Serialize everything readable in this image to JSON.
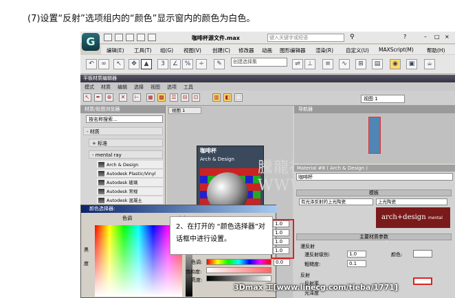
{
  "caption": "(7)设置“反射”选项组内的“颜色”显示窗内的颜色为白色。",
  "app": {
    "file_title": "咖啡杯源文件.max",
    "search_placeholder": "键入关键字或短语",
    "menus": [
      "编辑(E)",
      "工具(T)",
      "组(G)",
      "视图(V)",
      "创建(C)",
      "修改器",
      "动画",
      "图形编辑器",
      "渲染(R)",
      "自定义(U)",
      "MAXScript(M)",
      "帮助(H)"
    ],
    "selection_set": "创建选择集",
    "icons": [
      "new-file-icon",
      "open-icon",
      "save-icon",
      "undo-icon",
      "redo-icon",
      "link-icon",
      "select-icon",
      "move-icon",
      "rotate-icon",
      "scale-icon",
      "mirror-icon",
      "align-icon",
      "render-icon",
      "material-editor-icon"
    ]
  },
  "sme": {
    "title": "平板材质编辑器",
    "menus": [
      "模式",
      "材质",
      "编辑",
      "选择",
      "视图",
      "选项",
      "工具"
    ],
    "view_select": "视图 1",
    "browser_title": "材质/贴图浏览器",
    "search_label": "按名称搜索...",
    "groups": [
      "- 材质",
      "+ 标准",
      "- mental ray"
    ],
    "materials": [
      "Arch & Design",
      "Autodesk Plastic/Vinyl",
      "Autodesk 玻璃",
      "Autodesk 常规",
      "Autodesk 混凝土"
    ],
    "view_tab": "视图 1",
    "node_title": "咖啡杯",
    "node_subtitle": "Arch & Design",
    "watermark": "騰龍視覺 WWW.TLVI.NET",
    "navigator_title": "导航器"
  },
  "props": {
    "header": "Material #8  ( Arch & Design )",
    "material_name": "咖啡杯",
    "templates_section": "模板",
    "template_value": "有光泽反射的上光陶瓷",
    "template_dropdown": "上光陶瓷",
    "brand_main": "arch+design",
    "brand_sub": "mental ray",
    "main_section": "主要材质参数",
    "diffuse_group": "漫反射",
    "diffuse_level_label": "漫反射级别:",
    "diffuse_level": "1.0",
    "color_label": "颜色:",
    "roughness_label": "粗糙度:",
    "roughness": "0.1",
    "reflection_group": "反射",
    "reflectivity_label": "反射率",
    "gloss_label": "光泽度"
  },
  "dialog": {
    "title": "颜色选择器:",
    "hue_label": "色调",
    "white_label": "白度",
    "black_label": "黑",
    "degree_label": "度",
    "values": [
      "1.0",
      "1.0",
      "1.0",
      "1.0"
    ],
    "slider_labels": [
      "色调:",
      "饱和度:",
      "亮度:"
    ],
    "slider_values": [
      "0.0",
      "0.0",
      "1.0"
    ]
  },
  "callout": "2、在打开的 “颜色选择器”对话框中进行设置。",
  "footer": "3Dmax 工[www.linecg.com/tieba/1771]"
}
